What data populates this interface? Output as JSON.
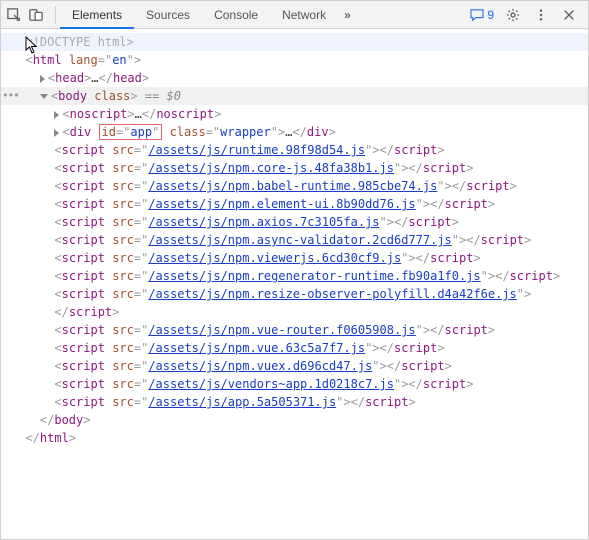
{
  "toolbar": {
    "tabs": [
      "Elements",
      "Sources",
      "Console",
      "Network"
    ],
    "active_tab": 0,
    "more_glyph": "»",
    "messages_count": "9"
  },
  "src": {
    "doctype": "<!DOCTYPE html>",
    "html_open": {
      "tag": "html",
      "attr": "lang",
      "val": "en"
    },
    "head": {
      "open": "head",
      "ell": "…",
      "close": "head"
    },
    "body_open": {
      "tag": "body",
      "attr": "class",
      "selected_marker": "== $0"
    },
    "noscript": {
      "open": "noscript",
      "ell": "…",
      "close": "noscript"
    },
    "div": {
      "tag": "div",
      "id_attr": "id",
      "id_val": "app",
      "class_attr": "class",
      "class_val": "wrapper",
      "ell": "…",
      "close": "div"
    },
    "scripts": [
      "/assets/js/runtime.98f98d54.js",
      "/assets/js/npm.core-js.48fa38b1.js",
      "/assets/js/npm.babel-runtime.985cbe74.js",
      "/assets/js/npm.element-ui.8b90dd76.js",
      "/assets/js/npm.axios.7c3105fa.js",
      "/assets/js/npm.async-validator.2cd6d777.js",
      "/assets/js/npm.viewerjs.6cd30cf9.js",
      "/assets/js/npm.regenerator-runtime.fb90a1f0.js",
      "/assets/js/npm.resize-observer-polyfill.d4a42f6e.js",
      "/assets/js/npm.vue-router.f0605908.js",
      "/assets/js/npm.vue.63c5a7f7.js",
      "/assets/js/npm.vuex.d696cd47.js",
      "/assets/js/vendors~app.1d0218c7.js",
      "/assets/js/app.5a505371.js"
    ],
    "script_tag": "script",
    "script_attr": "src",
    "body_close": "body",
    "html_close": "html",
    "pad1": "  ",
    "pad2": "    ",
    "pad3": "      "
  }
}
